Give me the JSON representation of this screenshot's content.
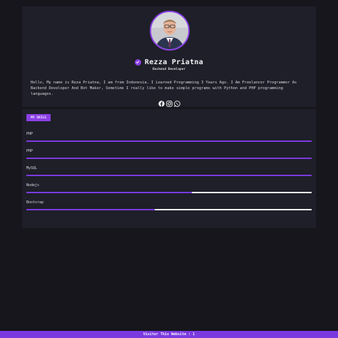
{
  "profile": {
    "name": "Rezza Priatna",
    "role": "Backend Developer",
    "bio": "Hello, My name is Reza Priatna, I am from Indonesia. I Learned Programming 3 Years Ago. I Am Freelancer Programmer As Backend Developer And Bot Maker, Sometime I really like to make simple programs with Python and PHP programming languages.",
    "socials": [
      {
        "icon": "facebook-icon"
      },
      {
        "icon": "instagram-icon"
      },
      {
        "icon": "whatsapp-icon"
      }
    ]
  },
  "skills": {
    "badge": "MY SKILS",
    "items": [
      {
        "label": "PHP",
        "level": 1.0
      },
      {
        "label": "PHP",
        "level": 1.0
      },
      {
        "label": "MySQL",
        "level": 1.0
      },
      {
        "label": "Nodejs",
        "level": 0.58
      },
      {
        "label": "Bootsrap",
        "level": 0.45
      }
    ]
  },
  "footer": {
    "text": "Visitor This Website : 1"
  },
  "colors": {
    "accent": "#7b3ae0",
    "background": "#16161c",
    "card": "#1e1f28",
    "track": "#f0f0f4"
  }
}
